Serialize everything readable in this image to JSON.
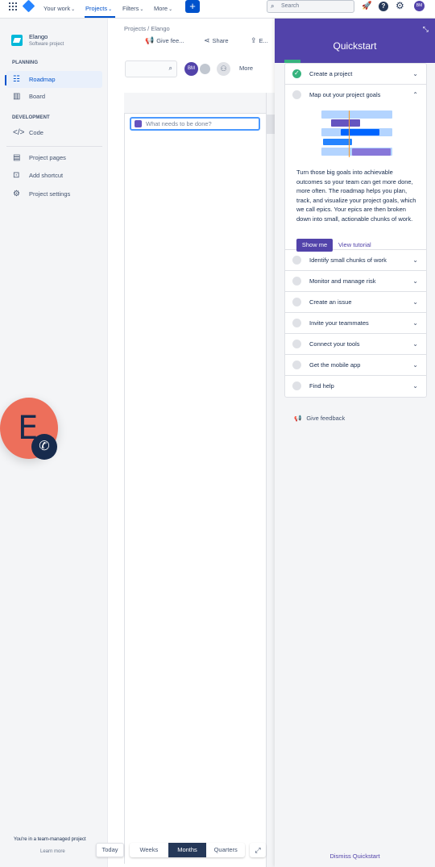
{
  "topnav": {
    "your_work": "Your work",
    "projects": "Projects",
    "filters": "Filters",
    "more": "More",
    "create": "+",
    "search_placeholder": "Search",
    "avatar_initials": "BM"
  },
  "sidebar": {
    "project_name": "Elango",
    "project_type": "Software project",
    "planning_heading": "PLANNING",
    "development_heading": "DEVELOPMENT",
    "items": [
      {
        "label": "Roadmap"
      },
      {
        "label": "Board"
      },
      {
        "label": "Code"
      },
      {
        "label": "Project pages"
      },
      {
        "label": "Add shortcut"
      },
      {
        "label": "Project settings"
      }
    ],
    "team_managed": "You're in a team-managed project",
    "learn_more": "Learn more"
  },
  "call_avatar": {
    "letter": "E"
  },
  "main": {
    "breadcrumb": "Projects  /  Elango",
    "toolbar": {
      "give_feedback": "Give fee...",
      "share": "Share",
      "export": "E..."
    },
    "avatar_initials": "BM",
    "more_label": "More",
    "epic_placeholder": "What needs to be done?",
    "today": "Today",
    "timescale": [
      "Weeks",
      "Months",
      "Quarters"
    ],
    "timescale_selected": "Months"
  },
  "quickstart": {
    "title": "Quickstart",
    "items": [
      {
        "label": "Create a project",
        "done": true
      },
      {
        "label": "Map out your project goals",
        "done": false
      },
      {
        "label": "Identify small chunks of work",
        "done": false
      },
      {
        "label": "Monitor and manage risk",
        "done": false
      },
      {
        "label": "Create an issue",
        "done": false
      },
      {
        "label": "Invite your teammates",
        "done": false
      },
      {
        "label": "Connect your tools",
        "done": false
      },
      {
        "label": "Get the mobile app",
        "done": false
      },
      {
        "label": "Find help",
        "done": false
      }
    ],
    "description": "Turn those big goals into achievable outcomes so your team can get more done, more often. The roadmap helps you plan, track, and visualize your project goals, which we call epics. Your epics are then broken down into small, actionable chunks of work.",
    "show_me": "Show me",
    "view_tutorial": "View tutorial",
    "give_feedback": "Give feedback",
    "dismiss": "Dismiss Quickstart"
  },
  "colors": {
    "brand": "#0052cc",
    "quickstart": "#5243aa",
    "success": "#36b37e"
  }
}
